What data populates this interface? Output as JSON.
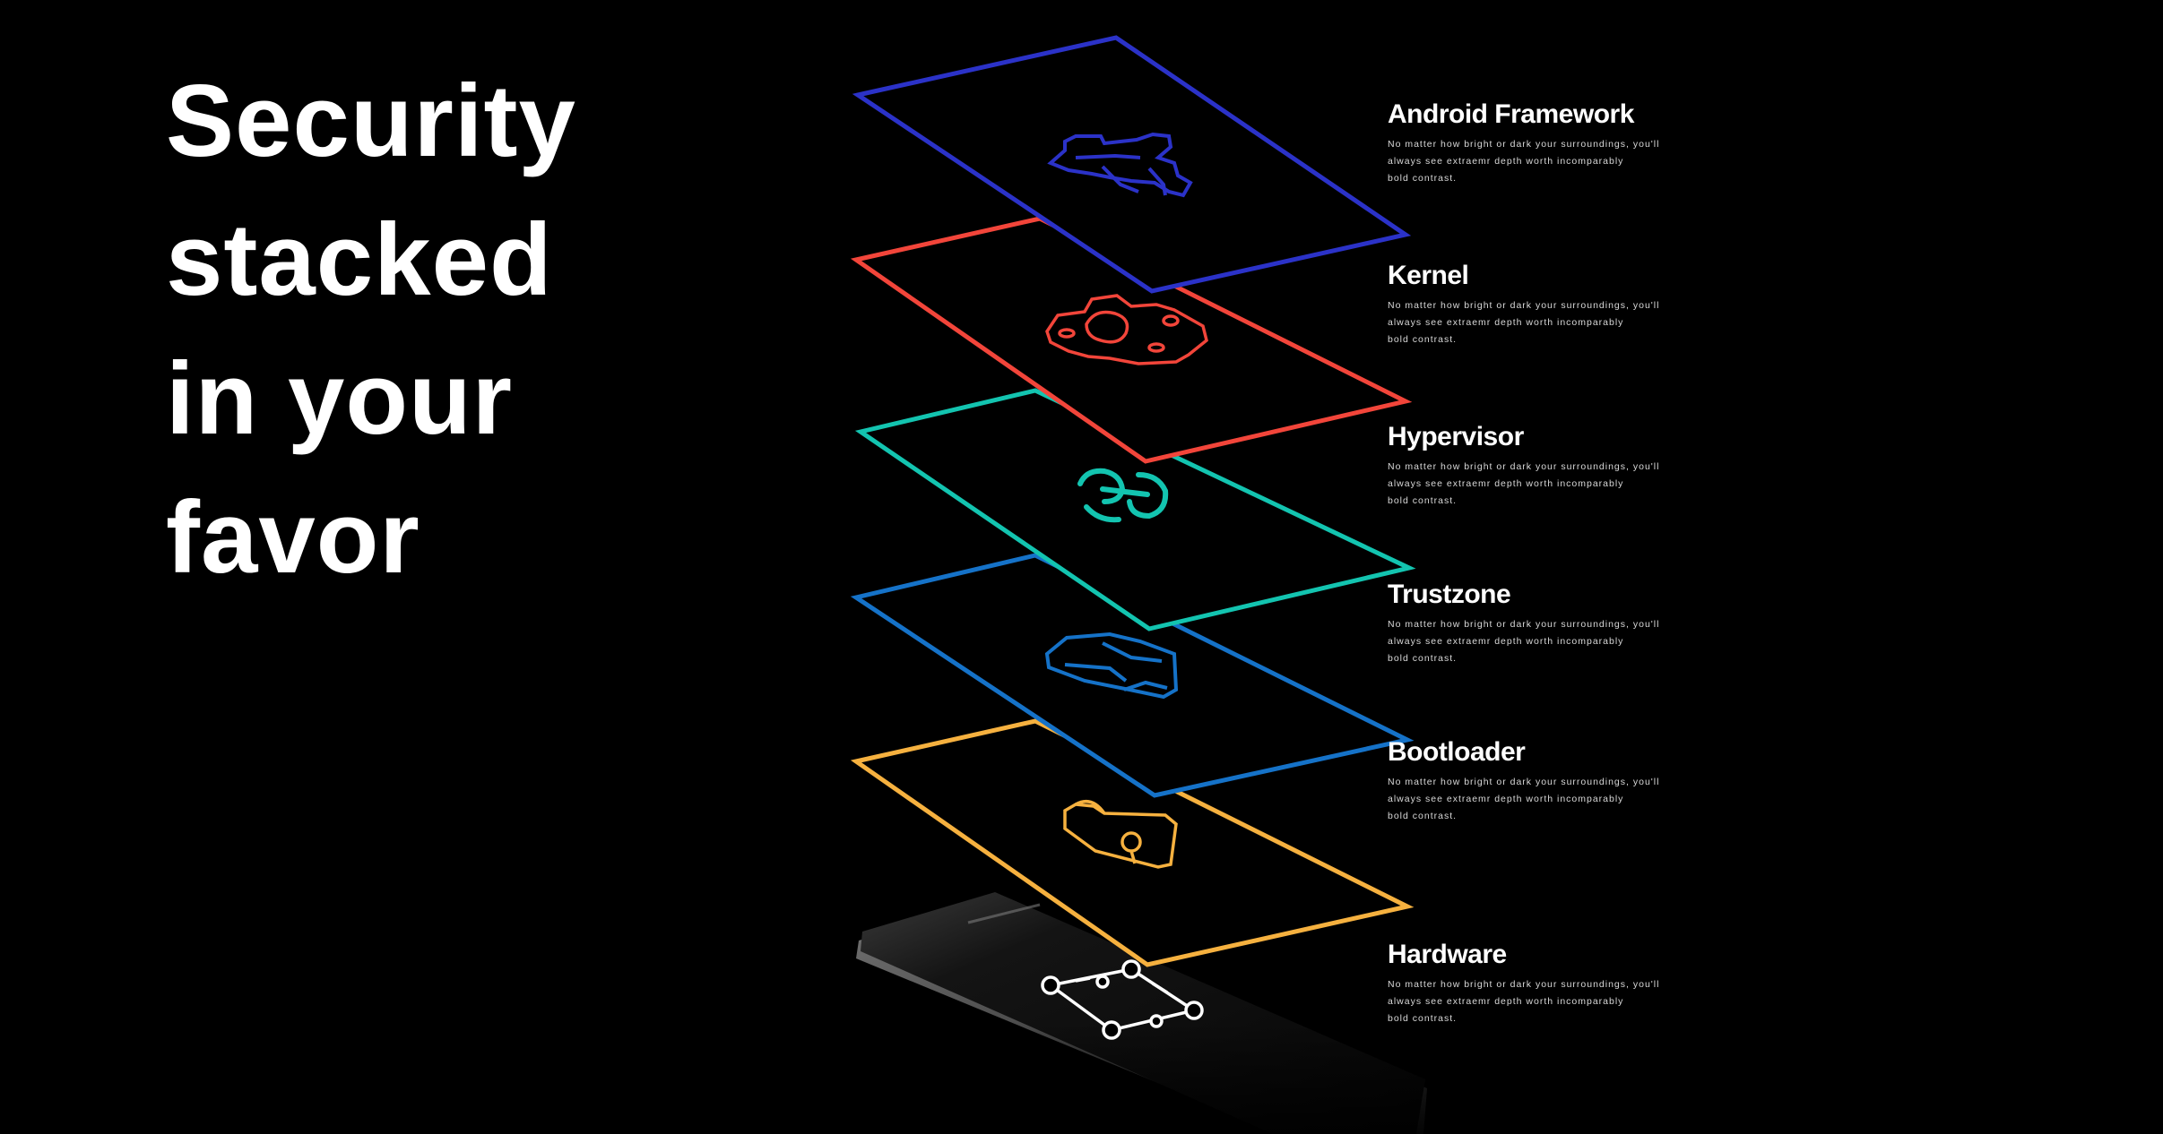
{
  "headline": {
    "line1": "Security",
    "line2": "stacked",
    "line3": "in your",
    "line4": "favor"
  },
  "layers": [
    {
      "title": "Android Framework",
      "desc_line1": "No matter how bright or dark your surroundings, you'll",
      "desc_line2": "always see extraemr depth worth incomparably",
      "desc_line3": "bold contrast.",
      "color": "#2b32c8",
      "icon": "chip-circuit-icon"
    },
    {
      "title": "Kernel",
      "desc_line1": "No matter how bright or dark your surroundings, you'll",
      "desc_line2": "always see extraemr depth worth incomparably",
      "desc_line3": "bold contrast.",
      "color": "#f2453a",
      "icon": "kernel-core-icon"
    },
    {
      "title": "Hypervisor",
      "desc_line1": "No matter how bright or dark your surroundings, you'll",
      "desc_line2": "always see extraemr depth worth incomparably",
      "desc_line3": "bold contrast.",
      "color": "#13c4b0",
      "icon": "hypervisor-link-icon"
    },
    {
      "title": "Trustzone",
      "desc_line1": "No matter how bright or dark your surroundings, you'll",
      "desc_line2": "always see extraemr depth worth incomparably",
      "desc_line3": "bold contrast.",
      "color": "#1572c8",
      "icon": "trustzone-shield-icon"
    },
    {
      "title": "Bootloader",
      "desc_line1": "No matter how bright or dark your surroundings, you'll",
      "desc_line2": "always see extraemr depth worth incomparably",
      "desc_line3": "bold contrast.",
      "color": "#f6b13f",
      "icon": "keyhole-lock-icon"
    },
    {
      "title": "Hardware",
      "desc_line1": "No matter how bright or dark your surroundings, you'll",
      "desc_line2": "always see extraemr depth worth incomparably",
      "desc_line3": "bold contrast.",
      "color": "#ffffff",
      "icon": "hardware-chip-icon"
    }
  ]
}
